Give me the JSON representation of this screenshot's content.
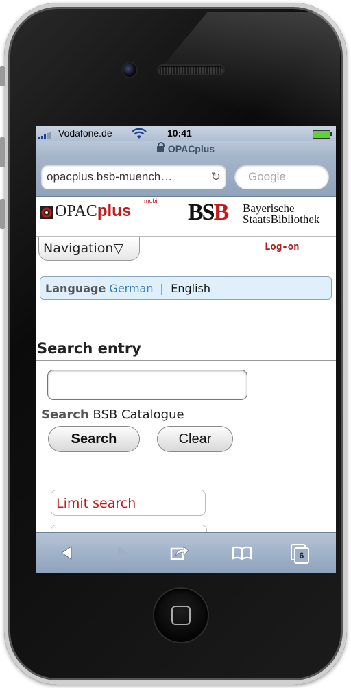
{
  "status": {
    "carrier": "Vodafone.de",
    "time": "10:41"
  },
  "browser": {
    "page_title": "OPACplus",
    "url": "opacplus.bsb-muench…",
    "search_placeholder": "Google",
    "tab_count": "6"
  },
  "header": {
    "logo_opac": "OPAC",
    "logo_plus": "plus",
    "logo_mobil": "mobil",
    "bsb_b1": "BS",
    "bsb_b2": "B",
    "bsb_line1": "Bayerische",
    "bsb_line2": "StaatsBibliothek"
  },
  "nav": {
    "navigation_label": "Navigation▽",
    "logon_label": "Log-on"
  },
  "language": {
    "label": "Language",
    "german": "German",
    "separator": "|",
    "english": "English"
  },
  "search": {
    "heading": "Search entry",
    "input_value": "",
    "label_bold": "Search",
    "catalogue": "BSB Catalogue",
    "search_button": "Search",
    "clear_button": "Clear",
    "limit_label": "Limit search"
  },
  "colors": {
    "accent_red": "#c41a1a",
    "link_blue": "#3a7db8",
    "lang_bg": "#dff0fb"
  }
}
